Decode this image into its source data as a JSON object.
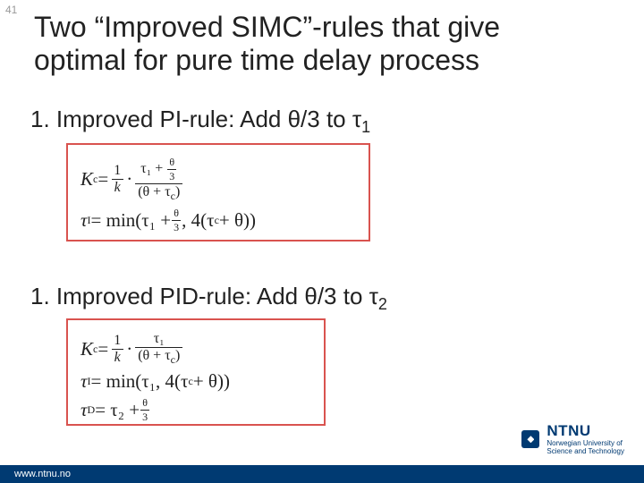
{
  "slide_number": "41",
  "title_line1": "Two “Improved SIMC”-rules that give",
  "title_line2": "optimal for pure time delay process",
  "item1_prefix": "1. Improved PI-rule: Add ",
  "item1_expr": "θ/3 to τ",
  "item1_sub": "1",
  "item2_prefix": "1. Improved PID-rule: Add ",
  "item2_expr": "θ/3 to τ",
  "item2_sub": "2",
  "f1": {
    "kc": "K",
    "kc_sub": "c",
    "eq": " = ",
    "one": "1",
    "k": "k",
    "dot": " · ",
    "num": "τ₁ + ",
    "theta": "θ",
    "three": "3",
    "den": "(θ + τ",
    "den_sub": "c",
    "den_tail": ")",
    "tauI": "τ",
    "tauI_sub": "I",
    "min_pre": " = min(τ₁ + ",
    "min_mid": ", 4(τ",
    "min_sub": "c",
    "min_tail": " + θ))"
  },
  "f2": {
    "kc": "K",
    "kc_sub": "c",
    "eq": " = ",
    "one": "1",
    "k": "k",
    "dot": " · ",
    "num": "τ₁",
    "den": "(θ + τ",
    "den_sub": "c",
    "den_tail": ")",
    "tauI": "τ",
    "tauI_sub": "I",
    "min": " = min(τ₁, 4(τ",
    "min_sub": "c",
    "min_tail": " + θ))",
    "tauD": "τ",
    "tauD_sub": "D",
    "td_eq": " = τ₂ + ",
    "theta": "θ",
    "three": "3"
  },
  "footer_url": "www.ntnu.no",
  "logo_main": "NTNU",
  "logo_line1": "Norwegian University of",
  "logo_line2": "Science and Technology"
}
